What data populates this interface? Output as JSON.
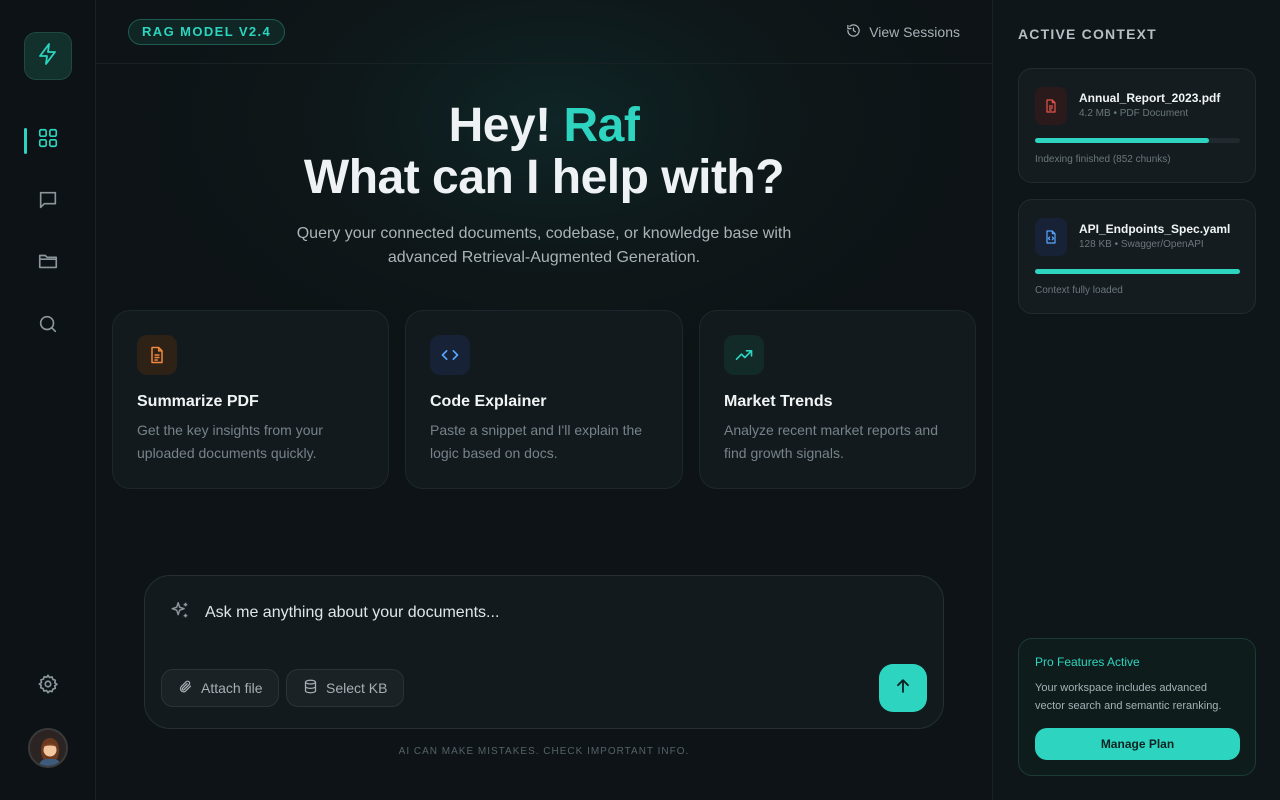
{
  "app": {
    "model_badge": "RAG MODEL V2.4",
    "view_sessions_label": "View Sessions"
  },
  "nav": {
    "items": [
      {
        "icon": "grid-icon",
        "active": true
      },
      {
        "icon": "chat-icon",
        "active": false
      },
      {
        "icon": "folder-icon",
        "active": false
      },
      {
        "icon": "search-icon",
        "active": false
      }
    ],
    "settings_icon": "gear-icon",
    "logo_icon": "lightning-icon"
  },
  "hero": {
    "greeting": "Hey!",
    "user_name": "Raf",
    "question": "What can I help with?",
    "subtitle": "Query your connected documents, codebase, or knowledge base with advanced Retrieval-Augmented Generation."
  },
  "cards": [
    {
      "title": "Summarize PDF",
      "description": "Get the key insights from your uploaded documents quickly.",
      "icon": "document-icon",
      "color": "#f0883e"
    },
    {
      "title": "Code Explainer",
      "description": "Paste a snippet and I'll explain the logic based on docs.",
      "icon": "code-icon",
      "color": "#58a6ff"
    },
    {
      "title": "Market Trends",
      "description": "Analyze recent market reports and find growth signals.",
      "icon": "trending-up-icon",
      "color": "#2dd4bf"
    }
  ],
  "composer": {
    "placeholder": "Ask me anything about your documents...",
    "attach_label": "Attach file",
    "select_kb_label": "Select KB",
    "disclaimer": "AI CAN MAKE MISTAKES. CHECK IMPORTANT INFO."
  },
  "context": {
    "title": "ACTIVE CONTEXT",
    "documents": [
      {
        "name": "Annual_Report_2023.pdf",
        "meta": "4.2 MB • PDF Document",
        "progress": 0.85,
        "status": "Indexing finished (852 chunks)",
        "icon": "pdf-file-icon",
        "color": "#e5534b"
      },
      {
        "name": "API_Endpoints_Spec.yaml",
        "meta": "128 KB • Swagger/OpenAPI",
        "progress": 1.0,
        "status": "Context fully loaded",
        "icon": "code-file-icon",
        "color": "#58a6ff"
      }
    ]
  },
  "pro": {
    "title": "Pro Features Active",
    "description": "Your workspace includes advanced vector search and semantic reranking.",
    "button_label": "Manage Plan"
  },
  "colors": {
    "accent": "#2dd4bf",
    "background": "#0d1316"
  }
}
